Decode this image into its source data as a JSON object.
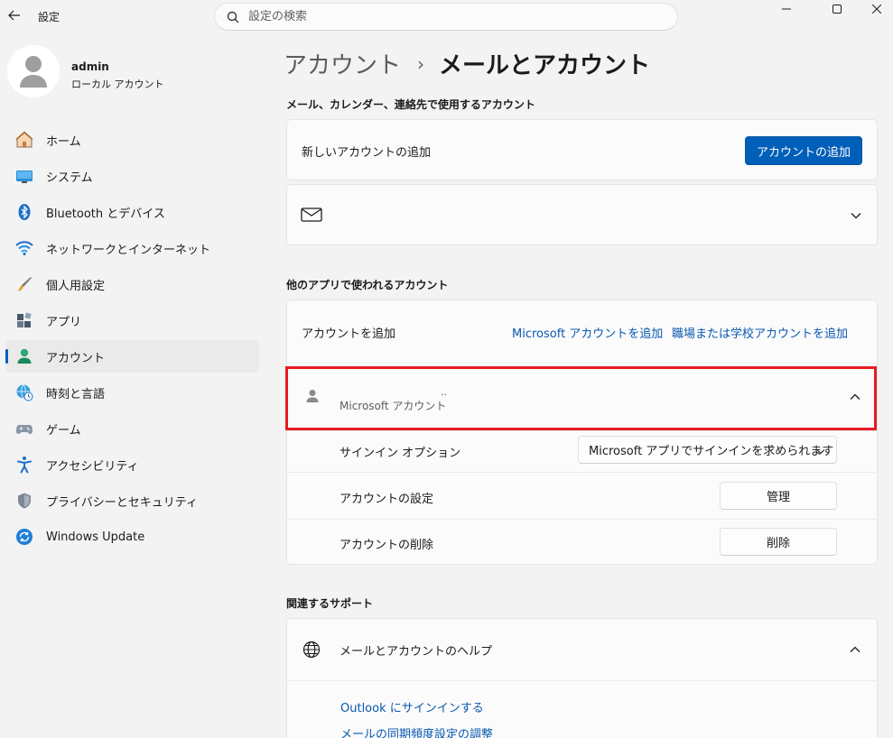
{
  "window": {
    "title": "設定",
    "search_placeholder": "設定の検索"
  },
  "profile": {
    "name": "admin",
    "type": "ローカル アカウント"
  },
  "nav": [
    {
      "label": "ホーム",
      "icon": "home-icon"
    },
    {
      "label": "システム",
      "icon": "system-icon"
    },
    {
      "label": "Bluetooth とデバイス",
      "icon": "bluetooth-icon"
    },
    {
      "label": "ネットワークとインターネット",
      "icon": "wifi-icon"
    },
    {
      "label": "個人用設定",
      "icon": "brush-icon"
    },
    {
      "label": "アプリ",
      "icon": "apps-icon"
    },
    {
      "label": "アカウント",
      "icon": "account-icon",
      "active": true
    },
    {
      "label": "時刻と言語",
      "icon": "globe-clock-icon"
    },
    {
      "label": "ゲーム",
      "icon": "gamepad-icon"
    },
    {
      "label": "アクセシビリティ",
      "icon": "accessibility-icon"
    },
    {
      "label": "プライバシーとセキュリティ",
      "icon": "shield-icon"
    },
    {
      "label": "Windows Update",
      "icon": "update-icon"
    }
  ],
  "breadcrumb": {
    "parent": "アカウント",
    "separator": "›",
    "current": "メールとアカウント"
  },
  "section_email": {
    "title": "メール、カレンダー、連絡先で使用するアカウント",
    "add_label": "新しいアカウントの追加",
    "add_button": "アカウントの追加"
  },
  "section_other": {
    "title": "他のアプリで使われるアカウント",
    "add_label": "アカウントを追加",
    "link_ms": "Microsoft アカウントを追加",
    "link_work": "職場または学校アカウントを追加",
    "account_dots": "··",
    "account_type": "Microsoft アカウント",
    "signin_label": "サインイン オプション",
    "signin_value": "Microsoft アプリでサインインを求められます",
    "settings_label": "アカウントの設定",
    "settings_button": "管理",
    "remove_label": "アカウントの削除",
    "remove_button": "削除"
  },
  "section_support": {
    "title": "関連するサポート",
    "help_label": "メールとアカウントのヘルプ",
    "links": [
      "Outlook にサインインする",
      "メールの同期頻度設定の調整"
    ]
  },
  "colors": {
    "accent": "#005fb8",
    "highlight": "#e51a22",
    "link": "#0a58b0"
  }
}
